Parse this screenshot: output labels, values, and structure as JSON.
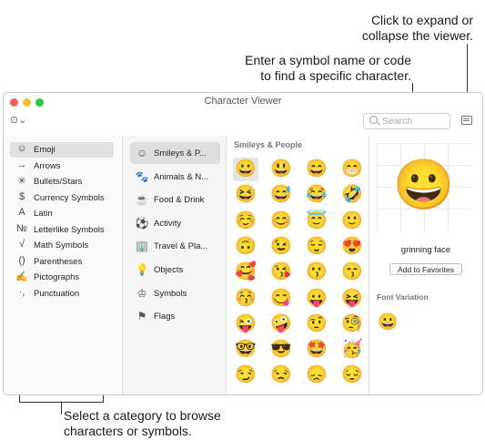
{
  "callouts": {
    "expand_line1": "Click to expand or",
    "expand_line2": "collapse the viewer.",
    "search_line1": "Enter a symbol name or code",
    "search_line2": "to find a specific character.",
    "category_line1": "Select a category to browse",
    "category_line2": "characters or symbols."
  },
  "window": {
    "title": "Character Viewer",
    "traffic_colors": [
      "#fe5f57",
      "#febc2e",
      "#28c840"
    ]
  },
  "toolbar": {
    "action_label": "⊙⌄",
    "search_placeholder": "Search",
    "search_value": "",
    "toggle_icon": "sidebar-toggle-icon"
  },
  "left_categories": [
    {
      "icon": "☺",
      "label": "Emoji",
      "selected": true
    },
    {
      "icon": "→",
      "label": "Arrows"
    },
    {
      "icon": "✳",
      "label": "Bullets/Stars"
    },
    {
      "icon": "$",
      "label": "Currency Symbols"
    },
    {
      "icon": "A",
      "label": "Latin"
    },
    {
      "icon": "№",
      "label": "Letterlike Symbols"
    },
    {
      "icon": "√",
      "label": "Math Symbols"
    },
    {
      "icon": "()",
      "label": "Parentheses"
    },
    {
      "icon": "✍",
      "label": "Pictographs"
    },
    {
      "icon": "·,",
      "label": "Punctuation"
    }
  ],
  "mid_categories": [
    {
      "icon": "☺",
      "label": "Smileys & P...",
      "selected": true
    },
    {
      "icon": "🐾",
      "label": "Animals & N..."
    },
    {
      "icon": "☕",
      "label": "Food & Drink"
    },
    {
      "icon": "⚽",
      "label": "Activity"
    },
    {
      "icon": "🏢",
      "label": "Travel & Pla..."
    },
    {
      "icon": "💡",
      "label": "Objects"
    },
    {
      "icon": "♔",
      "label": "Symbols"
    },
    {
      "icon": "⚑",
      "label": "Flags"
    }
  ],
  "grid": {
    "heading": "Smileys & People",
    "emoji": [
      "😀",
      "😃",
      "😄",
      "😁",
      "😆",
      "😅",
      "😂",
      "🤣",
      "☺️",
      "😊",
      "😇",
      "🙂",
      "🙃",
      "😉",
      "😌",
      "😍",
      "🥰",
      "😘",
      "😗",
      "😙",
      "😚",
      "😋",
      "😛",
      "😝",
      "😜",
      "🤪",
      "🤨",
      "🧐",
      "🤓",
      "😎",
      "🤩",
      "🥳",
      "😏",
      "😒",
      "😞",
      "😔"
    ]
  },
  "detail": {
    "emoji": "😀",
    "name": "grinning face",
    "favorites_button": "Add to Favorites",
    "font_variation_heading": "Font Variation",
    "variation_emoji": "😀"
  }
}
